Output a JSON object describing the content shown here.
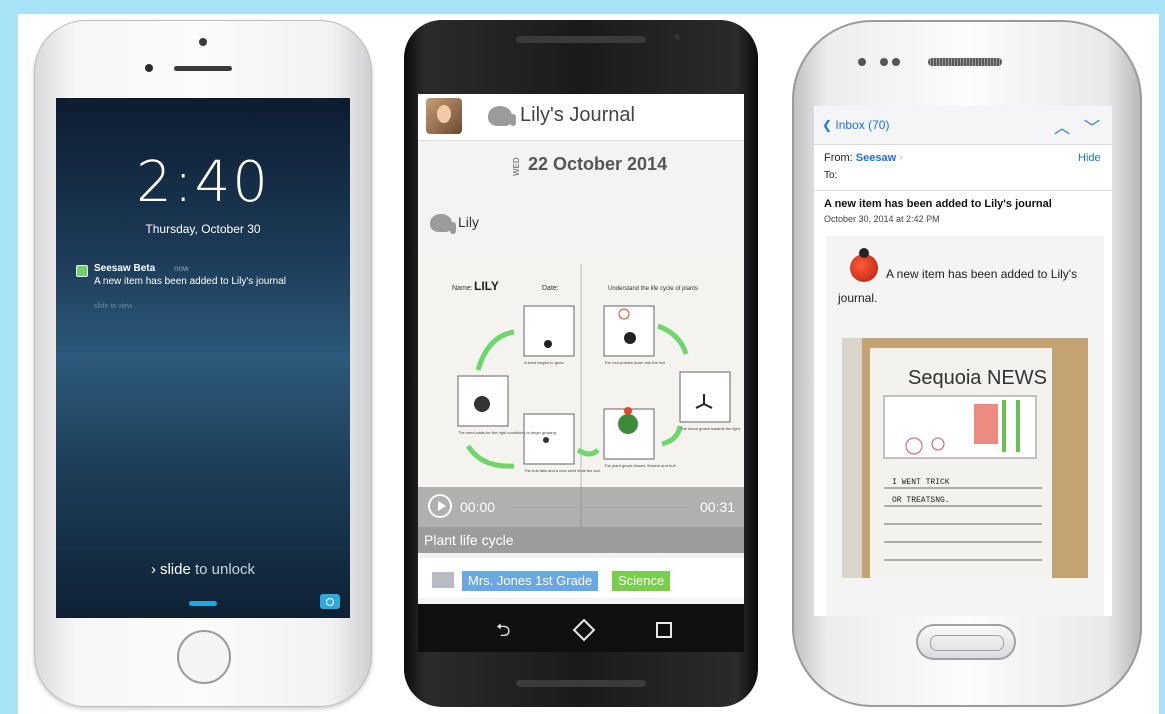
{
  "iphone": {
    "time": "2:40",
    "date": "Thursday, October 30",
    "notification": {
      "app": "Seesaw Beta",
      "age": "now",
      "message": "A new item has been added to Lily's journal",
      "hint": "slide to view"
    },
    "unlock": {
      "prefix": "slide",
      "suffix": " to unlock"
    }
  },
  "android": {
    "journal_title": "Lily's Journal",
    "day": "WED",
    "date": "22 October 2014",
    "author": "Lily",
    "worksheet": {
      "name_label": "Name:",
      "name_value": "LILY",
      "date_label": "Date:",
      "objective": "Understand the life cycle of plants",
      "captions": [
        "A seed begins to grow.",
        "The root pushes down into the soil.",
        "The shoot grows towards the light.",
        "The plant grows leaves, flowers and fruit.",
        "The fruit falls and a new seed finds the soil.",
        "The seed waits for the right conditions to begin growing"
      ]
    },
    "player": {
      "current": "00:00",
      "duration": "00:31"
    },
    "caption": "Plant life cycle",
    "tags": [
      "Mrs. Jones 1st Grade",
      "Science"
    ]
  },
  "samsung": {
    "back_label": "Inbox (70)",
    "from_label": "From:",
    "from_value": "Seesaw",
    "hide_label": "Hide",
    "to_label": "To:",
    "subject": "A new item has been added to Lily's journal",
    "timestamp": "October 30, 2014 at 2:42 PM",
    "body": "A new item has been added to Lily's journal.",
    "photo": {
      "headline": "Sequoia NEWS",
      "line1": "I  WENT  TRICK",
      "line2": "OR  TREATSNG."
    }
  },
  "colors": {
    "border": "#a9e3f7",
    "ios_blue": "#1a73e8",
    "tag_blue": "#69a8e6",
    "tag_green": "#78d04a"
  }
}
